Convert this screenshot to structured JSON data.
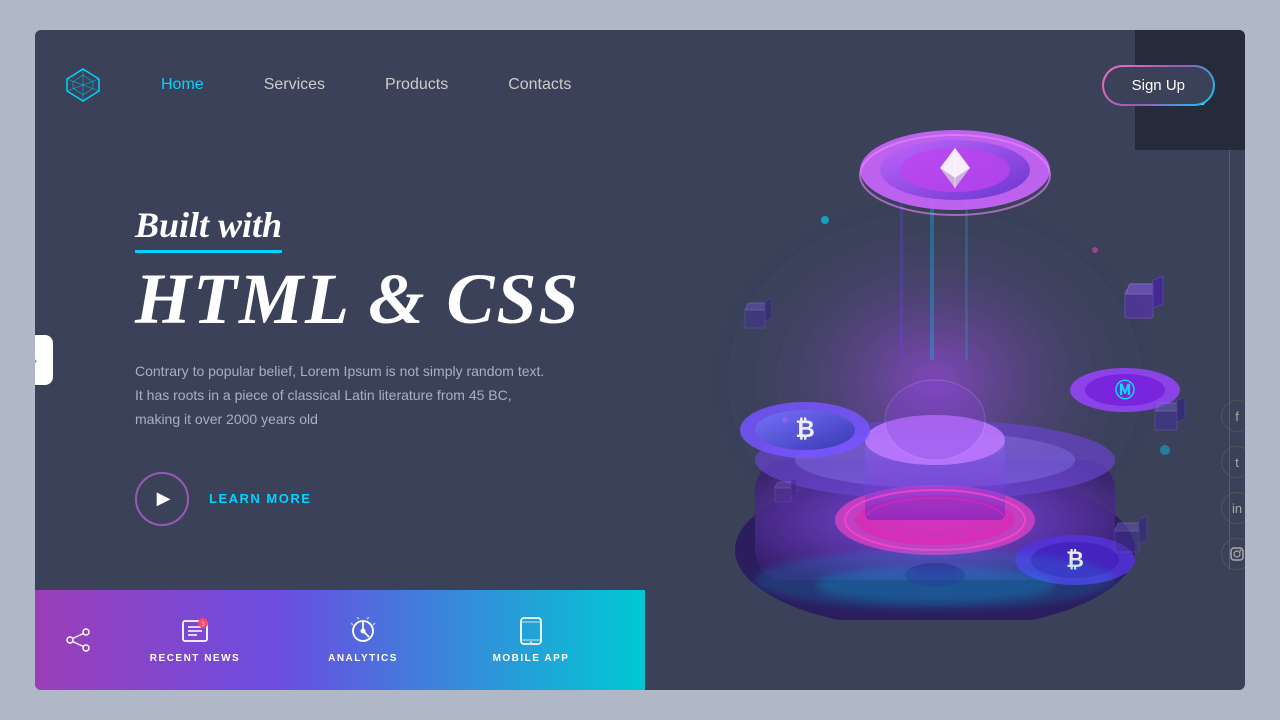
{
  "nav": {
    "logo_label": "logo-diamond",
    "links": [
      {
        "label": "Home",
        "active": true
      },
      {
        "label": "Services",
        "active": false
      },
      {
        "label": "Products",
        "active": false
      },
      {
        "label": "Contacts",
        "active": false
      }
    ],
    "signup_label": "Sign Up"
  },
  "hero": {
    "tagline": "Built with",
    "title": "HTML & CSS",
    "description": "Contrary to popular belief, Lorem Ipsum is not simply random text. It has roots in a piece of classical Latin literature from 45 BC, making it over 2000 years old",
    "cta_label": "LEARN MORE"
  },
  "bottom_bar": {
    "items": [
      {
        "icon": "share",
        "label": "RECENT NEWS"
      },
      {
        "icon": "chat",
        "label": "RECENT NEWS"
      },
      {
        "icon": "settings",
        "label": "ANALYTICS"
      },
      {
        "icon": "mobile",
        "label": "MOBILE APP"
      }
    ]
  },
  "social": {
    "icons": [
      "f",
      "t",
      "in",
      "ig"
    ]
  },
  "colors": {
    "bg": "#3a4159",
    "accent_cyan": "#00d4ff",
    "accent_purple": "#9b3eb8",
    "accent_pink": "#ff6ec7",
    "nav_active": "#00d4ff",
    "text_muted": "#aab0c0"
  }
}
